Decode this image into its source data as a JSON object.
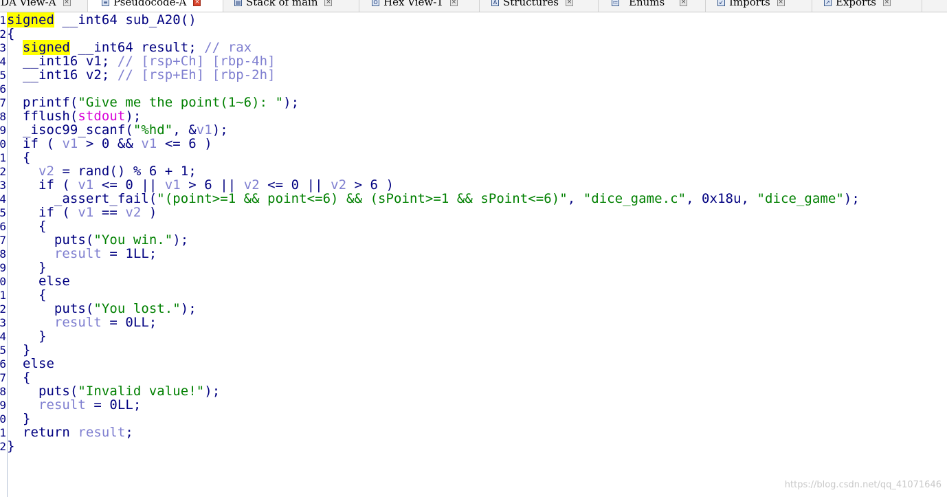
{
  "tabs": [
    {
      "label": "IDA View-A",
      "icon": "ida-view-icon",
      "active": false
    },
    {
      "label": "Pseudocode-A",
      "icon": "pseudocode-icon",
      "active": true
    },
    {
      "label": "Stack of main",
      "icon": "stack-icon",
      "active": false
    },
    {
      "label": "Hex View-1",
      "icon": "hex-view-icon",
      "active": false
    },
    {
      "label": "Structures",
      "icon": "structures-icon",
      "active": false
    },
    {
      "label": "Enums",
      "icon": "enums-icon",
      "active": false
    },
    {
      "label": "Imports",
      "icon": "imports-icon",
      "active": false
    },
    {
      "label": "Exports",
      "icon": "exports-icon",
      "active": false
    }
  ],
  "gutter_numbers": [
    "1",
    "2",
    "3",
    "4",
    "5",
    "6",
    "7",
    "8",
    "9",
    "0",
    "1",
    "2",
    "3",
    "4",
    "5",
    "6",
    "7",
    "8",
    "9",
    "0",
    "1",
    "2",
    "3",
    "4",
    "5",
    "6",
    "7",
    "8",
    "9",
    "0",
    "1",
    "2"
  ],
  "code_lines": [
    [
      {
        "t": "signed",
        "c": "hl"
      },
      {
        "t": " __int64 sub_A20()",
        "c": "kw"
      }
    ],
    [
      {
        "t": "{",
        "c": "kw"
      }
    ],
    [
      {
        "t": "  ",
        "c": "kw"
      },
      {
        "t": "signed",
        "c": "hl"
      },
      {
        "t": " __int64 result; ",
        "c": "kw"
      },
      {
        "t": "// rax",
        "c": "com"
      }
    ],
    [
      {
        "t": "  __int16 v1; ",
        "c": "kw"
      },
      {
        "t": "// [rsp+Ch] [rbp-4h]",
        "c": "com"
      }
    ],
    [
      {
        "t": "  __int16 v2; ",
        "c": "kw"
      },
      {
        "t": "// [rsp+Eh] [rbp-2h]",
        "c": "com"
      }
    ],
    [],
    [
      {
        "t": "  printf(",
        "c": "kw"
      },
      {
        "t": "\"Give me the point(1~6): \"",
        "c": "str"
      },
      {
        "t": ");",
        "c": "kw"
      }
    ],
    [
      {
        "t": "  fflush(",
        "c": "kw"
      },
      {
        "t": "stdout",
        "c": "sym"
      },
      {
        "t": ");",
        "c": "kw"
      }
    ],
    [
      {
        "t": "  _isoc99_scanf(",
        "c": "kw"
      },
      {
        "t": "\"%hd\"",
        "c": "str"
      },
      {
        "t": ", &",
        "c": "kw"
      },
      {
        "t": "v1",
        "c": "var"
      },
      {
        "t": ");",
        "c": "kw"
      }
    ],
    [
      {
        "t": "  if ( ",
        "c": "kw"
      },
      {
        "t": "v1",
        "c": "var"
      },
      {
        "t": " > 0 && ",
        "c": "kw"
      },
      {
        "t": "v1",
        "c": "var"
      },
      {
        "t": " <= 6 )",
        "c": "kw"
      }
    ],
    [
      {
        "t": "  {",
        "c": "kw"
      }
    ],
    [
      {
        "t": "    ",
        "c": "kw"
      },
      {
        "t": "v2",
        "c": "var"
      },
      {
        "t": " = rand() % 6 + 1;",
        "c": "kw"
      }
    ],
    [
      {
        "t": "    if ( ",
        "c": "kw"
      },
      {
        "t": "v1",
        "c": "var"
      },
      {
        "t": " <= 0 || ",
        "c": "kw"
      },
      {
        "t": "v1",
        "c": "var"
      },
      {
        "t": " > 6 || ",
        "c": "kw"
      },
      {
        "t": "v2",
        "c": "var"
      },
      {
        "t": " <= 0 || ",
        "c": "kw"
      },
      {
        "t": "v2",
        "c": "var"
      },
      {
        "t": " > 6 )",
        "c": "kw"
      }
    ],
    [
      {
        "t": "      _assert_fail(",
        "c": "kw"
      },
      {
        "t": "\"(point>=1 && point<=6) && (sPoint>=1 && sPoint<=6)\"",
        "c": "str"
      },
      {
        "t": ", ",
        "c": "kw"
      },
      {
        "t": "\"dice_game.c\"",
        "c": "str"
      },
      {
        "t": ", 0x18u, ",
        "c": "kw"
      },
      {
        "t": "\"dice_game\"",
        "c": "str"
      },
      {
        "t": ");",
        "c": "kw"
      }
    ],
    [
      {
        "t": "    if ( ",
        "c": "kw"
      },
      {
        "t": "v1",
        "c": "var"
      },
      {
        "t": " == ",
        "c": "kw"
      },
      {
        "t": "v2",
        "c": "var"
      },
      {
        "t": " )",
        "c": "kw"
      }
    ],
    [
      {
        "t": "    {",
        "c": "kw"
      }
    ],
    [
      {
        "t": "      puts(",
        "c": "kw"
      },
      {
        "t": "\"You win.\"",
        "c": "str"
      },
      {
        "t": ");",
        "c": "kw"
      }
    ],
    [
      {
        "t": "      ",
        "c": "kw"
      },
      {
        "t": "result",
        "c": "var"
      },
      {
        "t": " = 1LL;",
        "c": "kw"
      }
    ],
    [
      {
        "t": "    }",
        "c": "kw"
      }
    ],
    [
      {
        "t": "    else",
        "c": "kw"
      }
    ],
    [
      {
        "t": "    {",
        "c": "kw"
      }
    ],
    [
      {
        "t": "      puts(",
        "c": "kw"
      },
      {
        "t": "\"You lost.\"",
        "c": "str"
      },
      {
        "t": ");",
        "c": "kw"
      }
    ],
    [
      {
        "t": "      ",
        "c": "kw"
      },
      {
        "t": "result",
        "c": "var"
      },
      {
        "t": " = 0LL;",
        "c": "kw"
      }
    ],
    [
      {
        "t": "    }",
        "c": "kw"
      }
    ],
    [
      {
        "t": "  }",
        "c": "kw"
      }
    ],
    [
      {
        "t": "  else",
        "c": "kw"
      }
    ],
    [
      {
        "t": "  {",
        "c": "kw"
      }
    ],
    [
      {
        "t": "    puts(",
        "c": "kw"
      },
      {
        "t": "\"Invalid value!\"",
        "c": "str"
      },
      {
        "t": ");",
        "c": "kw"
      }
    ],
    [
      {
        "t": "    ",
        "c": "kw"
      },
      {
        "t": "result",
        "c": "var"
      },
      {
        "t": " = 0LL;",
        "c": "kw"
      }
    ],
    [
      {
        "t": "  }",
        "c": "kw"
      }
    ],
    [
      {
        "t": "  return ",
        "c": "kw"
      },
      {
        "t": "result",
        "c": "var"
      },
      {
        "t": ";",
        "c": "kw"
      }
    ],
    [
      {
        "t": "}",
        "c": "kw"
      }
    ]
  ],
  "watermark": "https://blog.csdn.net/qq_41071646",
  "colors": {
    "keyword": "#000080",
    "variable": "#7f7fd0",
    "string": "#008000",
    "symbol": "#d800d8",
    "highlight": "#ffff00"
  }
}
